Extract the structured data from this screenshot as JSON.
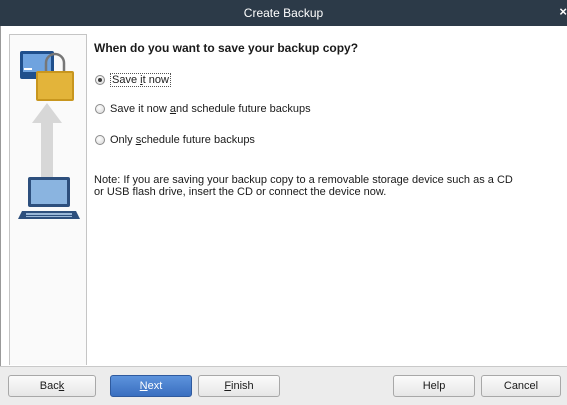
{
  "window": {
    "title": "Create Backup",
    "close_glyph": "×"
  },
  "icons": {
    "top": "safe-deposit-icon",
    "arrow": "up-arrow-icon",
    "bottom": "laptop-icon"
  },
  "main": {
    "question": "When do you want to save your backup copy?",
    "options": [
      {
        "label_pre": "Save ",
        "label_key": "i",
        "label_post": "t now",
        "checked": true
      },
      {
        "label_pre": "Save it now ",
        "label_key": "a",
        "label_post": "nd schedule future backups",
        "checked": false
      },
      {
        "label_pre": "Only ",
        "label_key": "s",
        "label_post": "chedule future backups",
        "checked": false
      }
    ],
    "note_line1": "Note: If you are saving your backup copy to a removable storage device such as a CD",
    "note_line2": "or USB flash drive, insert the CD or connect the device now."
  },
  "footer": {
    "back": {
      "pre": "Bac",
      "key": "k",
      "post": ""
    },
    "next": {
      "pre": "",
      "key": "N",
      "post": "ext"
    },
    "finish": {
      "pre": "",
      "key": "F",
      "post": "inish"
    },
    "help": "Help",
    "cancel": "Cancel"
  },
  "colors": {
    "titlebar": "#2c3a48",
    "primary_button": "#4a80cf"
  }
}
